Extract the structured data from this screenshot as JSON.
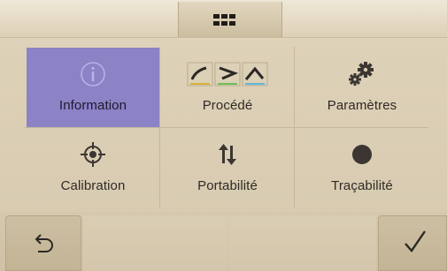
{
  "menu": {
    "items": [
      {
        "label": "Information",
        "icon": "info-icon",
        "selected": true
      },
      {
        "label": "Procédé",
        "icon": "process-icon",
        "selected": false
      },
      {
        "label": "Paramètres",
        "icon": "gears-icon",
        "selected": false
      },
      {
        "label": "Calibration",
        "icon": "crosshair-icon",
        "selected": false
      },
      {
        "label": "Portabilité",
        "icon": "transfer-arrows-icon",
        "selected": false
      },
      {
        "label": "Traçabilité",
        "icon": "record-dot-icon",
        "selected": false
      }
    ]
  },
  "toolbar": {
    "top_icon": "grid-menu-icon",
    "back_icon": "undo-arrow-icon",
    "confirm_icon": "checkmark-icon"
  },
  "colors": {
    "background": "#d9ccb2",
    "selected_tile": "#8c82c6",
    "process_line_1": "#d6b23a",
    "process_line_2": "#6cbf5a",
    "process_line_3": "#63b7d8"
  }
}
